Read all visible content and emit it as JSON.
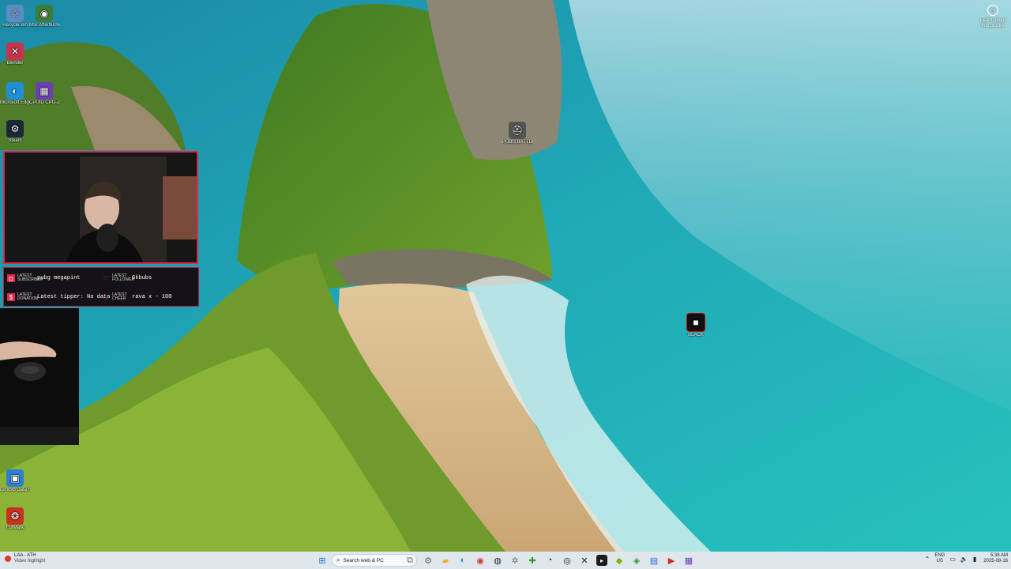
{
  "desktop_icons": [
    {
      "label": "Recycle Bin",
      "icon": "recycle-bin-icon",
      "glyph": "♲",
      "color": "#5a8dc4"
    },
    {
      "label": "MSI Afterburner",
      "icon": "afterburner-icon",
      "glyph": "◉",
      "color": "#3a7d3a"
    },
    {
      "label": "Blender",
      "icon": "x-app-icon",
      "glyph": "✕",
      "color": "#c8324a"
    },
    {
      "label": "Microsoft Edge",
      "icon": "edge-icon",
      "glyph": "◐",
      "color": "#1e8fd6"
    },
    {
      "label": "CPUID CPU-Z",
      "icon": "cpuz-icon",
      "glyph": "▦",
      "color": "#6a3fb5"
    },
    {
      "label": "Steam",
      "icon": "steam-icon",
      "glyph": "⚙",
      "color": "#1b2838"
    },
    {
      "label": "PUBG BATTLEGR...",
      "icon": "pubg-icon",
      "glyph": "⛑",
      "color": "#555555"
    },
    {
      "label": "BLACK",
      "icon": "black-app-icon",
      "glyph": "■",
      "color": "#111111"
    },
    {
      "label": "Lenovo Data Recovery",
      "icon": "data-recovery-icon",
      "glyph": "▣",
      "color": "#2f7fd0"
    },
    {
      "label": "FurMark",
      "icon": "furmark-icon",
      "glyph": "❂",
      "color": "#c8321e"
    }
  ],
  "learn_about": {
    "label": "Learn about this picture",
    "icon": "learn-about-icon"
  },
  "alerts": {
    "subscriber": {
      "kind": "LATEST SUBSCRIBER",
      "value": "pubg megapint"
    },
    "follower": {
      "kind": "LATEST FOLLOWER",
      "value": "Gkbubs"
    },
    "donation": {
      "kind": "LATEST DONATION",
      "value": "Latest tipper: No data"
    },
    "cheer": {
      "kind": "LATEST CHEER",
      "value": "rava x - 100"
    },
    "accent": "#e0274a"
  },
  "taskbar": {
    "weather_title": "LAA - ATH",
    "weather_sub": "Video highlight",
    "search_placeholder": "Search web & PC",
    "tray_lang": "ENG",
    "tray_region": "US",
    "time": "5:36 AM",
    "date": "2025-08-16",
    "apps": [
      "windows-start-icon",
      "task-view-icon",
      "settings-icon",
      "file-explorer-icon",
      "edge-icon",
      "chrome-icon",
      "steam-icon",
      "gear-icon",
      "xbox-icon",
      "discord-icon",
      "obs-icon",
      "close-app-icon",
      "terminal-icon",
      "nvidia-icon",
      "xbox-bar-icon",
      "visual-studio-icon",
      "app-red-icon",
      "cpuz-icon"
    ]
  }
}
